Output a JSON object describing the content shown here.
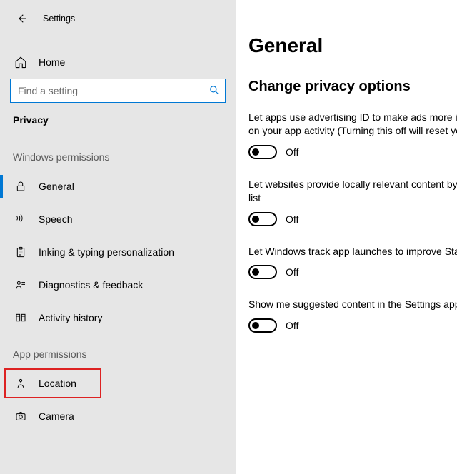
{
  "app_title": "Settings",
  "home_label": "Home",
  "search": {
    "placeholder": "Find a setting"
  },
  "active_section": "Privacy",
  "groups": {
    "windows_permissions": {
      "header": "Windows permissions",
      "items": [
        {
          "key": "general",
          "label": "General",
          "selected": true
        },
        {
          "key": "speech",
          "label": "Speech"
        },
        {
          "key": "inking",
          "label": "Inking & typing personalization"
        },
        {
          "key": "diagnostics",
          "label": "Diagnostics & feedback"
        },
        {
          "key": "activity",
          "label": "Activity history"
        }
      ]
    },
    "app_permissions": {
      "header": "App permissions",
      "items": [
        {
          "key": "location",
          "label": "Location",
          "highlighted": true
        },
        {
          "key": "camera",
          "label": "Camera"
        }
      ]
    }
  },
  "main": {
    "title": "General",
    "subtitle": "Change privacy options",
    "settings": [
      {
        "desc_line_a": "Let apps use advertising ID to make ads more in",
        "desc_line_b": "on your app activity (Turning this off will reset yo",
        "state_label": "Off"
      },
      {
        "desc_line_a": "Let websites provide locally relevant content by",
        "desc_line_b": "list",
        "state_label": "Off"
      },
      {
        "desc_line_a": "Let Windows track app launches to improve Sta",
        "desc_line_b": "",
        "state_label": "Off"
      },
      {
        "desc_line_a": "Show me suggested content in the Settings app",
        "desc_line_b": "",
        "state_label": "Off"
      }
    ]
  }
}
